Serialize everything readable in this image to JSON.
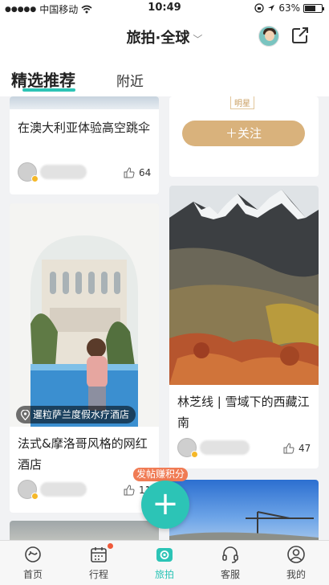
{
  "status": {
    "carrier": "中国移动",
    "time": "10:49",
    "battery": "63%",
    "battery_level": 0.63
  },
  "header": {
    "title": "旅拍·全球",
    "chevron": "﹀"
  },
  "tabs": {
    "recommended": "精选推荐",
    "nearby": "附近"
  },
  "feed": {
    "card1": {
      "title": "在澳大利亚体验高空跳伞",
      "likes": "64"
    },
    "card2": {
      "badge": "明星",
      "follow": "关注"
    },
    "card3": {
      "location": "暹粒萨兰度假水疗酒店",
      "title": "法式&摩洛哥风格的网红酒店",
      "likes": "11"
    },
    "card4": {
      "title": "林芝线 | 雪域下的西藏江南",
      "likes": "47"
    }
  },
  "post": {
    "bubble": "发帖赚积分",
    "plus": "+"
  },
  "tabbar": [
    {
      "label": "首页",
      "icon": "home-icon"
    },
    {
      "label": "行程",
      "icon": "calendar-icon"
    },
    {
      "label": "旅拍",
      "icon": "camera-icon"
    },
    {
      "label": "客服",
      "icon": "headset-icon"
    },
    {
      "label": "我的",
      "icon": "profile-icon"
    }
  ],
  "colors": {
    "accent": "#2cc4b6",
    "follow": "#d9b27c",
    "bubble": "#f07b54"
  }
}
